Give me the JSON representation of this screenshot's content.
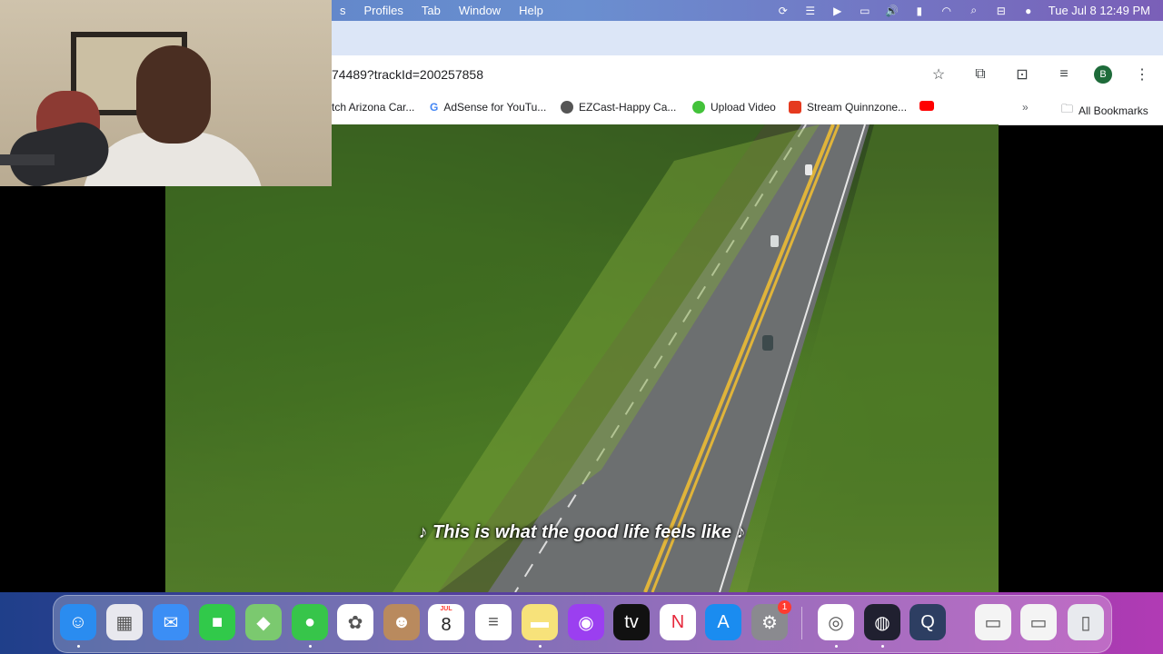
{
  "menubar": {
    "items": [
      "s",
      "Profiles",
      "Tab",
      "Window",
      "Help"
    ],
    "datetime": "Tue Jul 8  12:49 PM"
  },
  "browser": {
    "url": "74489?trackId=200257858",
    "avatar_letter": "B",
    "bookmarks": [
      {
        "label": "tch Arizona Car...",
        "icon": "generic-icon",
        "color": "#d9d9d9"
      },
      {
        "label": "AdSense for YouTu...",
        "icon": "google-icon",
        "color": "#4285f4"
      },
      {
        "label": "EZCast-Happy Ca...",
        "icon": "ezcast-icon",
        "color": "#555555"
      },
      {
        "label": "Upload Video",
        "icon": "upload-icon",
        "color": "#43c23a"
      },
      {
        "label": "Stream Quinnzone...",
        "icon": "stream-icon",
        "color": "#e53a1f"
      },
      {
        "label": "",
        "icon": "youtube-icon",
        "color": "#ff0000"
      }
    ],
    "all_bookmarks": "All Bookmarks"
  },
  "video": {
    "subtitle": "♪ This is what the good life feels like ♪"
  },
  "dock": {
    "calendar_month": "JUL",
    "calendar_day": "8",
    "settings_badge": "1",
    "apps": [
      {
        "name": "finder",
        "color": "#2a8cf0"
      },
      {
        "name": "launchpad",
        "color": "#e8e8ee"
      },
      {
        "name": "mail",
        "color": "#3b8ef5"
      },
      {
        "name": "facetime",
        "color": "#31c94a"
      },
      {
        "name": "maps",
        "color": "#7bc96f"
      },
      {
        "name": "messages",
        "color": "#37c54a"
      },
      {
        "name": "photos",
        "color": "#ffffff"
      },
      {
        "name": "contacts",
        "color": "#b98a5e"
      },
      {
        "name": "calendar",
        "color": "#ffffff"
      },
      {
        "name": "reminders",
        "color": "#ffffff"
      },
      {
        "name": "notes",
        "color": "#f7e27a"
      },
      {
        "name": "podcasts",
        "color": "#9b3ff0"
      },
      {
        "name": "appletv",
        "color": "#111111"
      },
      {
        "name": "news",
        "color": "#ffffff"
      },
      {
        "name": "appstore",
        "color": "#1a8cf0"
      },
      {
        "name": "system-settings",
        "color": "#8a8a8f"
      },
      {
        "name": "chrome",
        "color": "#ffffff"
      },
      {
        "name": "obs",
        "color": "#202030"
      },
      {
        "name": "quicktime",
        "color": "#2d3e62"
      },
      {
        "name": "recent-window-1",
        "color": "#f4f4f4"
      },
      {
        "name": "recent-window-2",
        "color": "#f4f4f4"
      },
      {
        "name": "trash",
        "color": "#e8eaee"
      }
    ]
  }
}
